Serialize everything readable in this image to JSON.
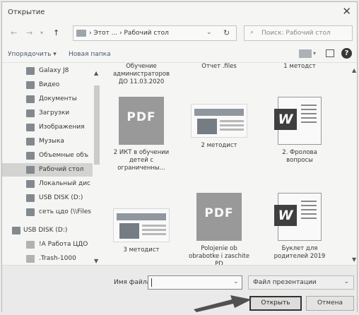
{
  "window": {
    "title": "Открытие"
  },
  "address": {
    "breadcrumb": "› Этот ... › Рабочий стол",
    "search_placeholder": "Поиск: Рабочий стол"
  },
  "toolbar": {
    "organize": "Упорядочить ▾",
    "new_folder": "Новая папка"
  },
  "sidebar": {
    "items": [
      {
        "label": "Galaxy J8"
      },
      {
        "label": "Видео"
      },
      {
        "label": "Документы"
      },
      {
        "label": "Загрузки"
      },
      {
        "label": "Изображения"
      },
      {
        "label": "Музыка"
      },
      {
        "label": "Объемные объ"
      },
      {
        "label": "Рабочий стол",
        "selected": true
      },
      {
        "label": "Локальный дис"
      },
      {
        "label": "USB DISK (D:)"
      },
      {
        "label": "сеть цдо (\\\\Files"
      },
      {
        "label": "USB DISK (D:)"
      },
      {
        "label": "!А Работа ЦДО"
      },
      {
        "label": ".Trash-1000"
      }
    ]
  },
  "files": [
    {
      "name": "Обучение администраторов ДО 11.03.2020",
      "kind": "partial"
    },
    {
      "name": "Отчет .files",
      "kind": "partial"
    },
    {
      "name": "1 методст",
      "kind": "partial"
    },
    {
      "name": "2 ИКТ в обучении детей с ограниченны...",
      "kind": "pdf",
      "badge": "PDF"
    },
    {
      "name": "2 методист",
      "kind": "photo"
    },
    {
      "name": "2. Фролова вопросы",
      "kind": "word",
      "badge": "W"
    },
    {
      "name": "3 методист",
      "kind": "photo"
    },
    {
      "name": "Polojenie ob obrabotke i zaschite PD",
      "kind": "pdf",
      "badge": "PDF"
    },
    {
      "name": "Буклет для родителей 2019",
      "kind": "word",
      "badge": "W"
    }
  ],
  "footer": {
    "filename_label": "Имя файла:",
    "filename_value": "",
    "filetype_value": "Файл презентации",
    "open_label": "Открыть",
    "cancel_label": "Отмена"
  }
}
